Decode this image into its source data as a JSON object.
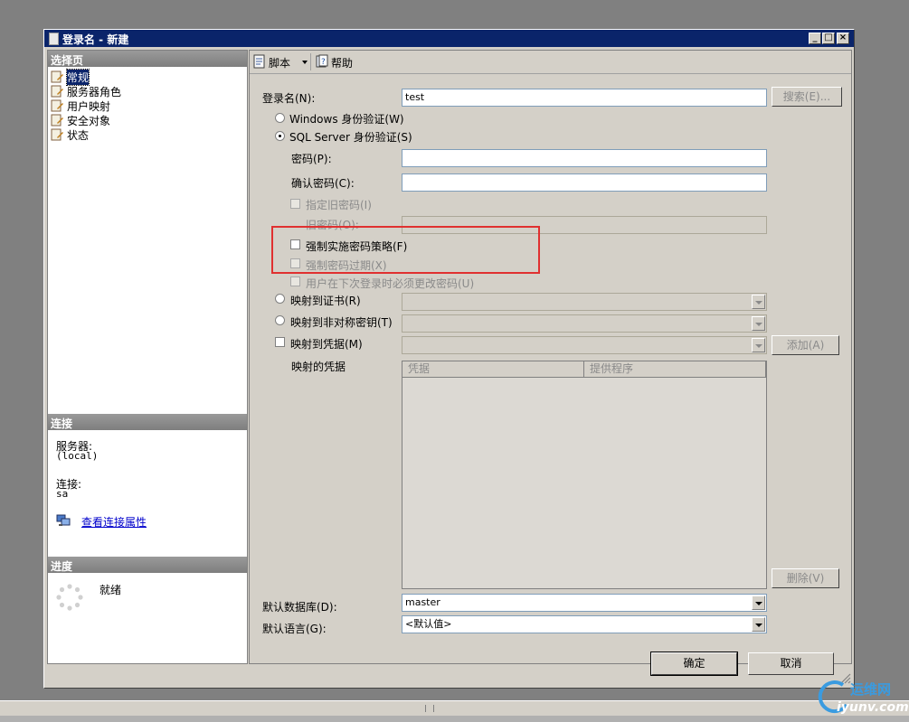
{
  "window": {
    "title": "登录名 - 新建",
    "controls": [
      "_",
      "□",
      "×"
    ]
  },
  "left_pane": {
    "select_page_header": "选择页",
    "pages": [
      {
        "label": "常规",
        "selected": true
      },
      {
        "label": "服务器角色",
        "selected": false
      },
      {
        "label": "用户映射",
        "selected": false
      },
      {
        "label": "安全对象",
        "selected": false
      },
      {
        "label": "状态",
        "selected": false
      }
    ],
    "connection_header": "连接",
    "server_label": "服务器:",
    "server_value": "(local)",
    "connection_label": "连接:",
    "connection_value": "sa",
    "view_properties_link": "查看连接属性",
    "progress_header": "进度",
    "progress_status": "就绪"
  },
  "toolbar": {
    "script_label": "脚本",
    "help_label": "帮助"
  },
  "form": {
    "login_name_label": "登录名(N):",
    "login_name_value": "test",
    "search_button": "搜索(E)...",
    "windows_auth_label": "Windows 身份验证(W)",
    "sql_auth_label": "SQL Server 身份验证(S)",
    "password_label": "密码(P):",
    "confirm_password_label": "确认密码(C):",
    "specify_old_password_label": "指定旧密码(I)",
    "old_password_label": "旧密码(O):",
    "enforce_policy_label": "强制实施密码策略(F)",
    "enforce_expiration_label": "强制密码过期(X)",
    "must_change_label": "用户在下次登录时必须更改密码(U)",
    "map_certificate_label": "映射到证书(R)",
    "map_asymmetric_key_label": "映射到非对称密钥(T)",
    "map_credential_label": "映射到凭据(M)",
    "add_button": "添加(A)",
    "mapped_credentials_label": "映射的凭据",
    "grid_columns": [
      "凭据",
      "提供程序"
    ],
    "remove_button": "删除(V)",
    "default_database_label": "默认数据库(D):",
    "default_database_value": "master",
    "default_language_label": "默认语言(G):",
    "default_language_value": "<默认值>"
  },
  "footer": {
    "ok_button": "确定",
    "cancel_button": "取消"
  },
  "watermark": {
    "text1": "运维网",
    "text2": "iyunv.com"
  },
  "colors": {
    "title_bar": "#0a246a",
    "highlight_box": "#e03030",
    "dialog_face": "#d4d0c8"
  }
}
